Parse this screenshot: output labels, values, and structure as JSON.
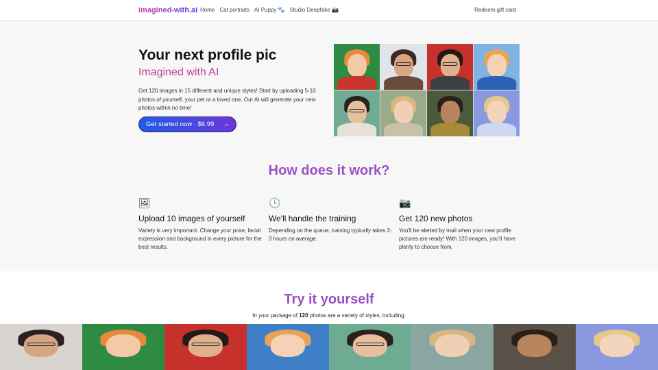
{
  "nav": {
    "logo": "imagined-with.ai",
    "links": [
      "Home",
      "Cat portraits",
      "AI Puppy 🐾",
      "Studio Deepfake 📸"
    ],
    "gift": "Redeem gift card"
  },
  "hero": {
    "title": "Your next profile pic",
    "subtitle": "Imagined with AI",
    "description": "Get 120 images in 15 different and unique styles! Start by uploading 5-10 photos of yourself, your pet or a loved one. Our AI will generate your new photos within no time!",
    "cta": "Get started now · $6.99",
    "cta_arrow": "→"
  },
  "how": {
    "title": "How does it work?",
    "steps": [
      {
        "icon": "image-icon",
        "glyph": "🖼",
        "title": "Upload 10 images of yourself",
        "text": "Variety is very important. Change your pose, facial expression and background in every picture for the best results."
      },
      {
        "icon": "clock-icon",
        "glyph": "🕒",
        "title": "We'll handle the training",
        "text": "Depending on the queue, training typically takes 2-3 hours on average."
      },
      {
        "icon": "camera-icon",
        "glyph": "📷",
        "title": "Get 120 new photos",
        "text": "You'll be alerted by mail when your new profile pictures are ready! With 120 images, you'll have plenty to choose from."
      }
    ]
  },
  "try": {
    "title": "Try it yourself",
    "sub_pre": "In your package of ",
    "sub_count": "120",
    "sub_post": " photos are a variety of styles, including:"
  },
  "colors": {
    "accent": "#9b4fc4",
    "pink": "#c13f96",
    "cta_start": "#1f5be6",
    "cta_end": "#6d35d9"
  }
}
